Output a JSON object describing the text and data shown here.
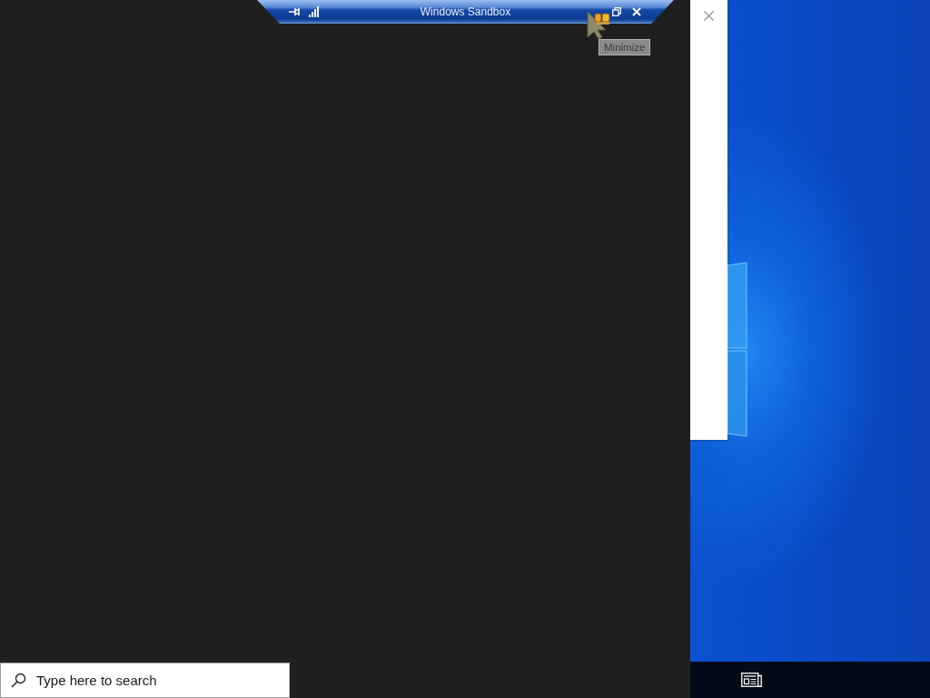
{
  "connection_bar": {
    "title": "Windows Sandbox",
    "tooltip": "Minimize"
  },
  "search": {
    "placeholder": "Type here to search"
  }
}
